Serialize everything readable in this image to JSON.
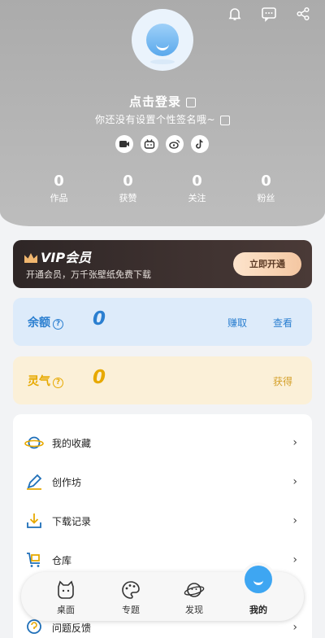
{
  "profile": {
    "login_text": "点击登录",
    "signature": "你还没有设置个性签名哦~"
  },
  "top_icons": [
    "bell-icon",
    "message-icon",
    "share-icon"
  ],
  "social": [
    "video-icon",
    "bilibili-icon",
    "weibo-icon",
    "tiktok-icon"
  ],
  "stats": [
    {
      "value": "0",
      "label": "作品"
    },
    {
      "value": "0",
      "label": "获赞"
    },
    {
      "value": "0",
      "label": "关注"
    },
    {
      "value": "0",
      "label": "粉丝"
    }
  ],
  "vip": {
    "title": "VIP会员",
    "subtitle": "开通会员，万千张壁纸免费下载",
    "button": "立即开通"
  },
  "balance": {
    "label": "余额",
    "help": "?",
    "value": "0",
    "earn": "赚取",
    "view": "查看"
  },
  "spirit": {
    "label": "灵气",
    "help": "?",
    "value": "0",
    "get": "获得"
  },
  "menu": [
    {
      "label": "我的收藏",
      "icon": "planet-icon"
    },
    {
      "label": "创作坊",
      "icon": "pen-icon"
    },
    {
      "label": "下载记录",
      "icon": "download-icon"
    },
    {
      "label": "仓库",
      "icon": "cart-icon"
    },
    {
      "label": "问题反馈",
      "icon": "feedback-icon"
    }
  ],
  "chevron": "›",
  "nav": [
    {
      "label": "桌面",
      "icon": "cat-icon"
    },
    {
      "label": "专题",
      "icon": "palette-icon"
    },
    {
      "label": "发现",
      "icon": "planet-icon"
    },
    {
      "label": "我的",
      "icon": "face-icon",
      "active": true
    }
  ],
  "colors": {
    "accent_blue": "#2b7fd0",
    "accent_gold": "#e7a900",
    "vip_bg": "#2e2626",
    "active_nav": "#3ea6f2"
  }
}
